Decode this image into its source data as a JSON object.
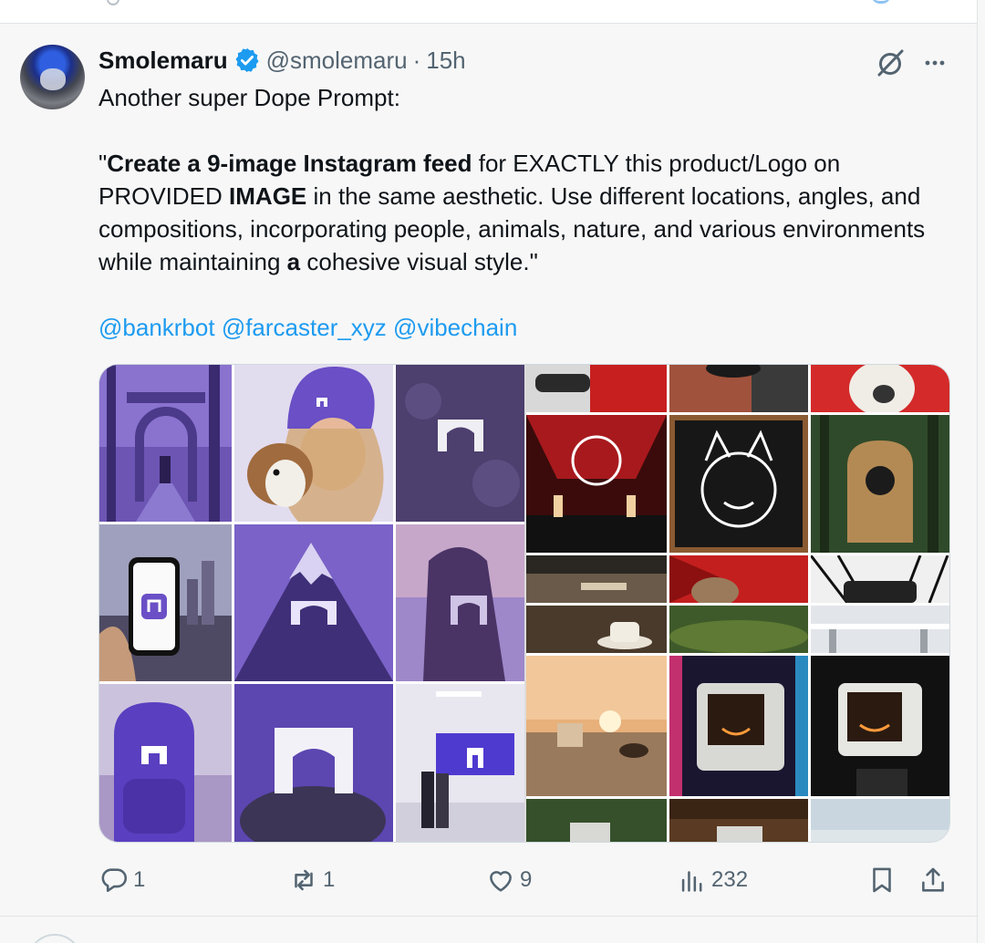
{
  "tweet": {
    "author_name": "Smolemaru",
    "handle": "@smolemaru",
    "separator": "·",
    "time": "15h",
    "text_line1": "Another super Dope Prompt:",
    "p2_a": "\"",
    "p2_b1": "Create a 9-image Instagram feed",
    "p2_c": " for EXACTLY this product/Logo on PROVIDED ",
    "p2_b2": "IMAGE",
    "p2_d": " in the same aesthetic. Use different locations, angles, and compositions, incorporating people, animals, nature, and various environments while maintaining ",
    "p2_b3": "a",
    "p2_e": " cohesive visual style.\"",
    "mentions": [
      "@bankrbot",
      "@farcaster_xyz",
      "@vibechain"
    ]
  },
  "actions": {
    "replies": "1",
    "reposts": "1",
    "likes": "9",
    "views": "232"
  },
  "icons": {
    "verified": "verified-badge-icon",
    "grok": "grok-icon",
    "more": "more-icon",
    "reply": "reply-icon",
    "repost": "repost-icon",
    "like": "like-icon",
    "views": "views-icon",
    "bookmark": "bookmark-icon",
    "share": "share-icon"
  },
  "colors": {
    "accent": "#1d9bf0",
    "text": "#0f1419",
    "secondary": "#536471",
    "purple": "#6a4fc6"
  }
}
